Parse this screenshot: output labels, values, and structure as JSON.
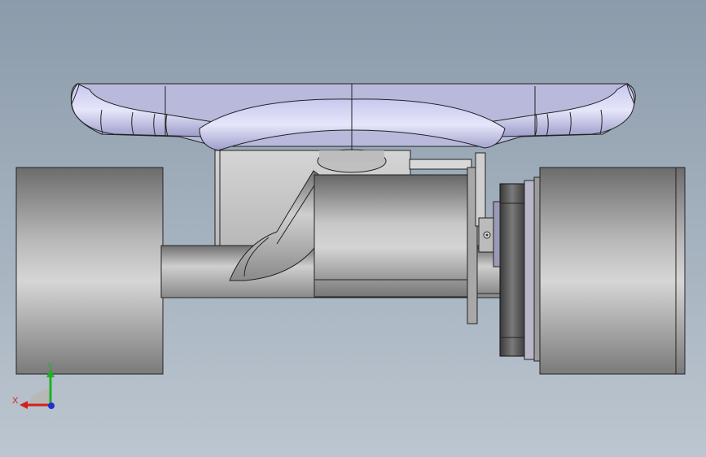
{
  "viewport": {
    "background_top": "#8b9bab",
    "background_bottom": "#bcc6d0"
  },
  "model": {
    "description_parts": [
      "deck",
      "truck",
      "wheel-left",
      "wheel-right",
      "motor",
      "pulley",
      "bearing"
    ]
  },
  "triad": {
    "x_label": "X",
    "y_label": "Y",
    "x_color": "#d02020",
    "y_color": "#20b020",
    "z_color": "#2030d0"
  }
}
